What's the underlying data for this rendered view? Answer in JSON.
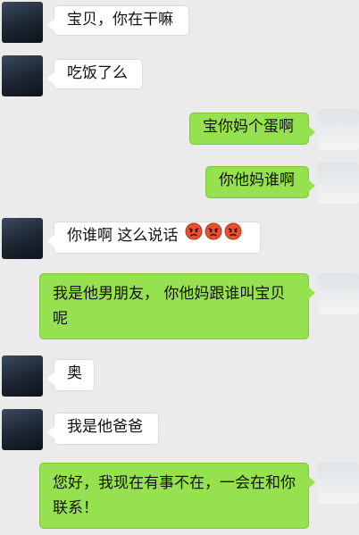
{
  "messages": [
    {
      "side": "in",
      "text": "宝贝，你在干嘛"
    },
    {
      "side": "in",
      "text": "吃饭了么"
    },
    {
      "side": "out",
      "text": "宝你妈个蛋啊"
    },
    {
      "side": "out",
      "text": "你他妈谁啊"
    },
    {
      "side": "in",
      "text": "你谁啊  这么说话",
      "emojis": [
        "angry-face-icon",
        "angry-face-icon",
        "angry-face-icon"
      ]
    },
    {
      "side": "out",
      "text": "我是他男朋友，  你他妈跟谁叫宝贝呢"
    },
    {
      "side": "in",
      "text": "奥"
    },
    {
      "side": "in",
      "text": "我是他爸爸"
    },
    {
      "side": "out",
      "text": "您好，我现在有事不在，一会在和你联系！"
    }
  ],
  "colors": {
    "background": "#ebebeb",
    "incoming_bubble": "#ffffff",
    "outgoing_bubble": "#96e14f"
  }
}
